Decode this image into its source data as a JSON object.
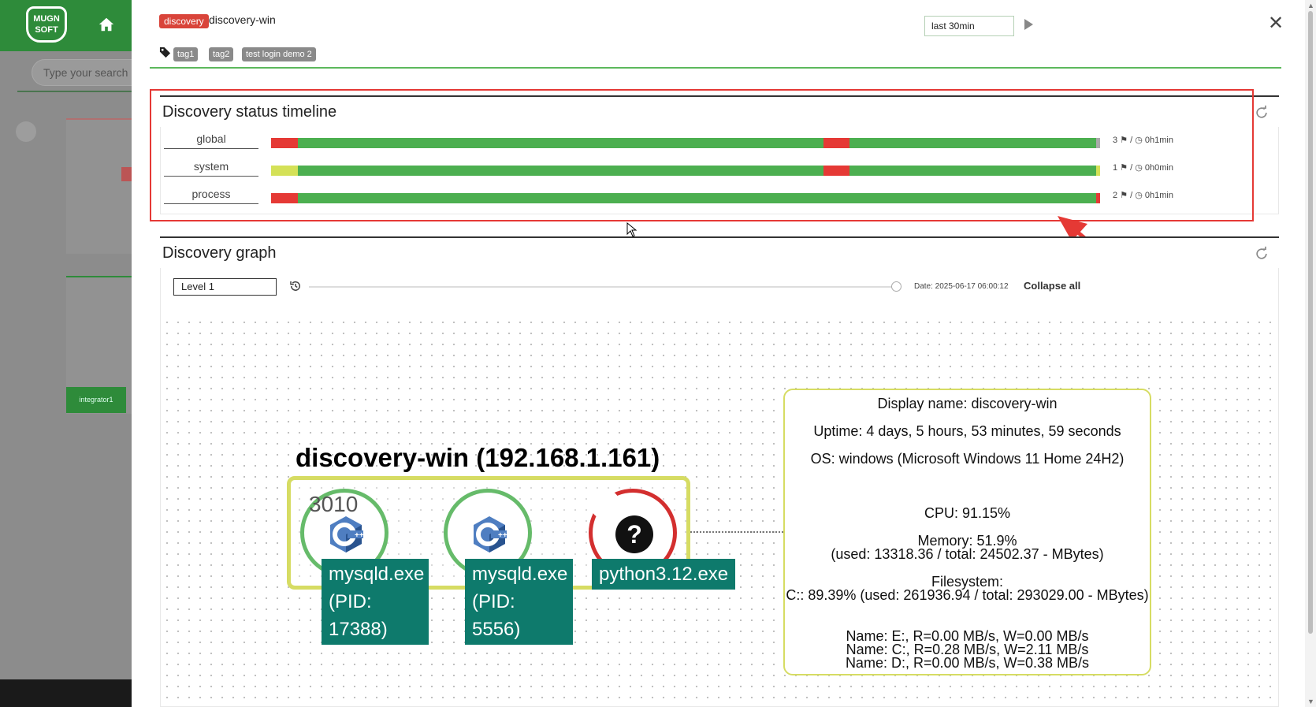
{
  "background": {
    "logo_text": "MUGN SOFT",
    "search_placeholder": "Type your search",
    "integrator_label": "integrator1"
  },
  "header": {
    "badge": "discovery",
    "title": "discovery-win",
    "tags": [
      "tag1",
      "tag2",
      "test login demo 2"
    ],
    "time_range": "last 30min"
  },
  "timeline": {
    "title": "Discovery status timeline",
    "rows": [
      {
        "label": "global",
        "count": "3",
        "duration": "0h1min"
      },
      {
        "label": "system",
        "count": "1",
        "duration": "0h0min"
      },
      {
        "label": "process",
        "count": "2",
        "duration": "0h1min"
      }
    ],
    "colors": {
      "ok": "#4caf50",
      "error": "#e53935",
      "warning": "#d4e157"
    }
  },
  "graph": {
    "title": "Discovery graph",
    "level": "Level 1",
    "date_text": "Date: 2025-06-17 06:00:12",
    "collapse_label": "Collapse all",
    "host_title": "discovery-win (192.168.1.161)",
    "port": "3010",
    "nodes": [
      {
        "label": "mysqld.exe\n(PID:\n17388)",
        "icon": "cpp-icon",
        "status": "ok"
      },
      {
        "label": "mysqld.exe\n(PID: 5556)",
        "icon": "cpp-icon",
        "status": "ok"
      },
      {
        "label": "python3.12.exe",
        "icon": "question-icon",
        "status": "error"
      }
    ],
    "info": {
      "display_name": "Display name: discovery-win",
      "uptime": "Uptime: 4 days, 5 hours, 53 minutes, 59 seconds",
      "os": "OS: windows (Microsoft Windows 11 Home 24H2)",
      "cpu": "CPU: 91.15%",
      "memory": "Memory: 51.9%",
      "memory_detail": "(used: 13318.36 / total: 24502.37 - MBytes)",
      "filesystem": "Filesystem:",
      "filesystem_detail": "C:: 89.39% (used: 261936.94 / total: 293029.00 - MBytes)",
      "disk_e": "Name: E:, R=0.00 MB/s, W=0.00 MB/s",
      "disk_c": "Name: C:, R=0.28 MB/s, W=2.11 MB/s",
      "disk_d": "Name: D:, R=0.00 MB/s, W=0.38 MB/s"
    }
  }
}
